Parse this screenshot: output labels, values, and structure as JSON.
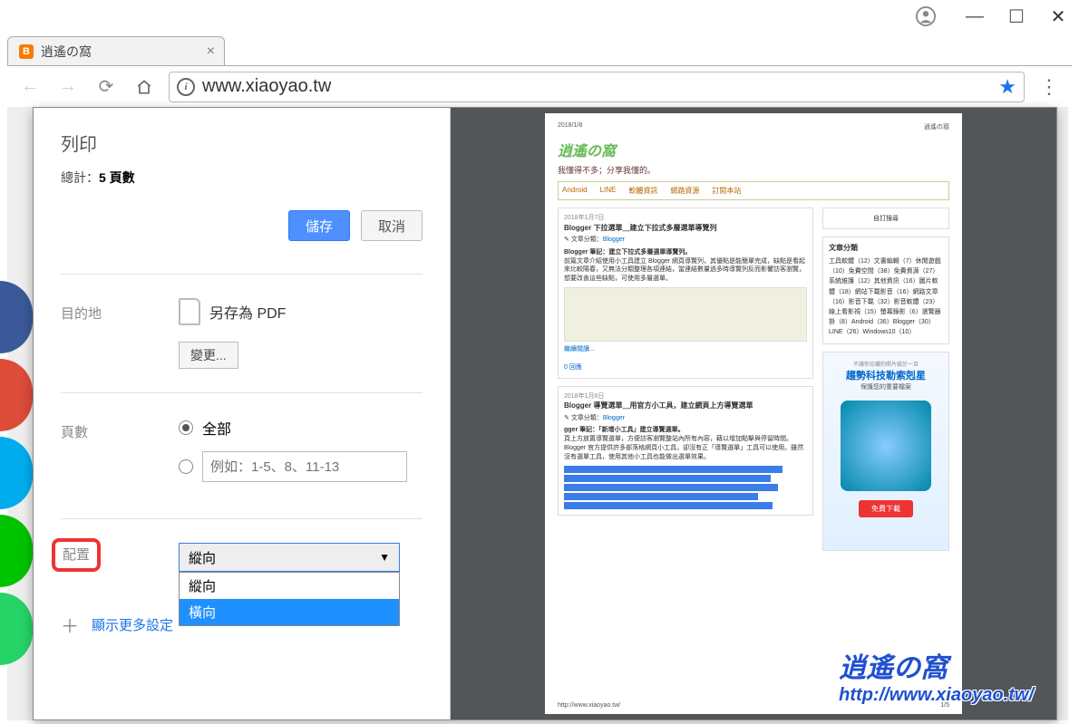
{
  "window": {
    "account": "●"
  },
  "tab": {
    "title": "逍遙の窩",
    "favicon_letter": "B"
  },
  "nav": {
    "url": "www.xiaoyao.tw"
  },
  "print": {
    "title": "列印",
    "total_label": "總計：",
    "total_value": "5 頁數",
    "save_btn": "儲存",
    "cancel_btn": "取消",
    "dest_label": "目的地",
    "dest_value": "另存為 PDF",
    "change_btn": "變更...",
    "pages_label": "頁數",
    "pages_all": "全部",
    "pages_placeholder": "例如：1-5、8、11-13",
    "layout_label": "配置",
    "layout_selected": "縱向",
    "layout_options": [
      "縱向",
      "橫向"
    ],
    "more": "顯示更多設定"
  },
  "preview": {
    "date": "2018/1/8",
    "sitename": "逍遙の窩",
    "logo": "逍遙の窩",
    "tagline": "我懂得不多；分享我懂的。",
    "menu": [
      "Android",
      "LINE",
      "軟體資訊",
      "網路資源",
      "訂閱本站"
    ],
    "sidebar_sub": "自訂搜尋",
    "post1": {
      "date": "2018年1月7日",
      "title": "Blogger 下拉選單＿建立下拉式多層選單導覽列",
      "cat_label": "文章分類：",
      "cat": "Blogger",
      "subtitle": "Blogger 筆記：建立下拉式多層選單導覽列。",
      "body": "前篇文章介紹使用小工具建立 Blogger 網頁導覽列，其優點是能簡單完成，缺點是看起來比較陽春，又無法分類整理各項連結，當連結數量過多時導覽列反而影響訪客瀏覽，想要改善這些缺點，可使用多層選單。",
      "readmore": "繼續閱讀...",
      "comments": "0 回應"
    },
    "post2": {
      "date": "2018年1月6日",
      "title": "Blogger 導覽選單＿用官方小工具，建立網頁上方導覽選單",
      "cat_label": "文章分類：",
      "cat": "Blogger",
      "subtitle": "gger 筆記：「新增小工具」建立導覽選單。",
      "body": "頁上方放置導覽選單，方便訪客瀏覽整站內所有內容，藉以增加點擊與停留時間。Blogger 官方提供許多部落格網頁小工具，卻沒有正「導覽選單」工具可以使用。雖然沒有選單工具，使用其他小工具也能做出選單效果。"
    },
    "side_cat": {
      "title": "文章分類",
      "tags": "工具軟體（12）文書編輯（7）休閒遊戲（10）免費空間（38）免費資源（27）系統維護（12）其他資訊（16）圖片軟體（18）網站下載影音（16）網路文章（16）影音下載（32）影音軟體（23）線上看影視（15）螢幕錄影（6）瀏覽器掛（8）Android（36）Blogger（30）LINE（26）Windows10（10）"
    },
    "ad": {
      "tag": "不讓你珍藏的照片毀於一旦",
      "title": "趨勢科技勒索剋星",
      "sub": "保護您的重要檔案",
      "btn": "免費下載"
    },
    "footer_url": "http://www.xiaoyao.tw/",
    "footer_page": "1/5"
  },
  "watermark": {
    "logo": "逍遙の窩",
    "url": "http://www.xiaoyao.tw/"
  }
}
